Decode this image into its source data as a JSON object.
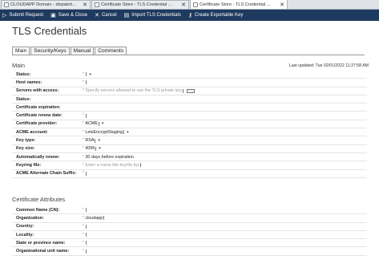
{
  "browser_tabs": [
    {
      "title": "CLOUDAPP Domain - dispatch...",
      "active": false,
      "close": "✕"
    },
    {
      "title": "Certificate Store - TLS Credential ...",
      "active": false,
      "close": "✕"
    },
    {
      "title": "Certificate Store - TLS Credential ...",
      "active": true,
      "close": "✕"
    }
  ],
  "toolbar": {
    "submit_label": "Submit Request",
    "save_close_label": "Save & Close",
    "cancel_label": "Cancel",
    "import_label": "Import TLS Credentials",
    "create_key_label": "Create Exportable Key"
  },
  "page": {
    "title": "TLS Credentials",
    "tabs": [
      "Main",
      "Security/Keys",
      "Manual",
      "Comments"
    ],
    "active_tab": "Main"
  },
  "main": {
    "section_title": "Main",
    "last_updated": "Last updated: Tue 02/01/2022 11:27:58 AM",
    "fields": [
      {
        "label": "Status:",
        "value": "",
        "kind": "select"
      },
      {
        "label": "Host names:",
        "value": "",
        "kind": "text"
      },
      {
        "label": "Servers with access:",
        "value": "",
        "placeholder": "Specify servers allowed to use the TLS private key",
        "kind": "picker"
      },
      {
        "label": "Status:",
        "value": "",
        "kind": "readonly"
      },
      {
        "label": "Certificate expiration:",
        "value": "",
        "kind": "readonly"
      },
      {
        "label": "Certificate renew date:",
        "value": "",
        "kind": "text"
      },
      {
        "label": "Certificate provider:",
        "value": "ACME",
        "kind": "select"
      },
      {
        "label": "ACME account:",
        "value": "LetsEncryptStaging",
        "kind": "select"
      },
      {
        "label": "Key type:",
        "value": "RSA",
        "kind": "select"
      },
      {
        "label": "Key size:",
        "value": "4096",
        "kind": "select"
      },
      {
        "label": "Automatically renew:",
        "value": "30",
        "suffix": "days before expiration",
        "kind": "number"
      },
      {
        "label": "Keyring file:",
        "value": "",
        "placeholder": "Enter a name like keyfile.kyr",
        "kind": "text"
      },
      {
        "label": "ACME Alternate Chain Suffix:",
        "value": "",
        "kind": "text"
      }
    ]
  },
  "attributes": {
    "section_title": "Certificate Attributes",
    "fields": [
      {
        "label": "Common Name (CN):",
        "value": ""
      },
      {
        "label": "Organization:",
        "value": "cloudapp"
      },
      {
        "label": "Country:",
        "value": ""
      },
      {
        "label": "Locality:",
        "value": ""
      },
      {
        "label": "State or province name:",
        "value": ""
      },
      {
        "label": "Organizational unit name:",
        "value": ""
      }
    ]
  },
  "icons": {
    "edit_marker": "⌜",
    "dropdown": "▾",
    "submit": "▷",
    "save": "▣",
    "cancel": "✕",
    "import": "▤",
    "key": "⚷"
  }
}
